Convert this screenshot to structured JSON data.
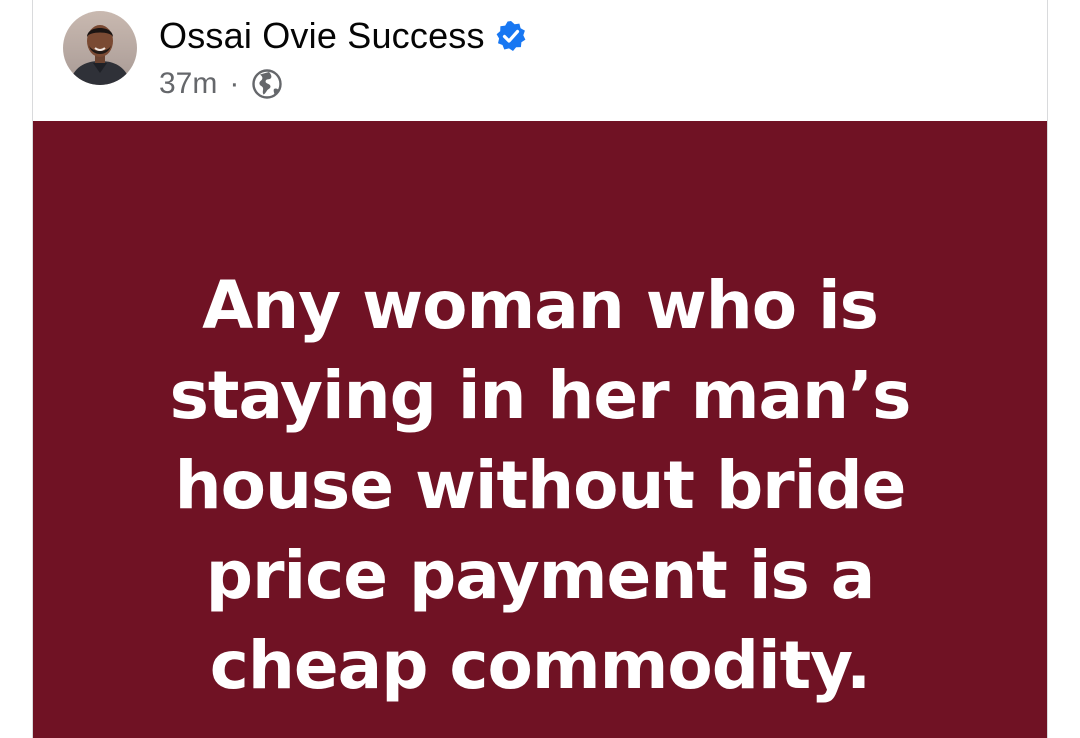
{
  "post": {
    "author": {
      "name": "Ossai Ovie Success",
      "verified": true,
      "avatar_icon": "profile-photo"
    },
    "meta": {
      "time": "37m",
      "separator": "·",
      "audience_icon": "globe-icon"
    },
    "content": {
      "background_color": "#701224",
      "text_color": "#ffffff",
      "lines": [
        "Any woman who is",
        "staying in her man’s",
        "house without bride",
        "price payment is a",
        "cheap commodity."
      ]
    }
  },
  "colors": {
    "verified_badge": "#1877f2",
    "meta_text": "#65676b",
    "name_text": "#050505"
  }
}
